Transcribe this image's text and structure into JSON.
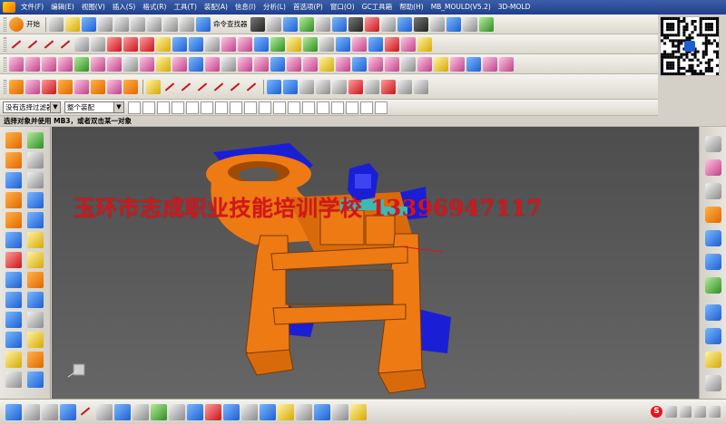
{
  "menubar": {
    "items": [
      "文件(F)",
      "编辑(E)",
      "视图(V)",
      "插入(S)",
      "格式(R)",
      "工具(T)",
      "装配(A)",
      "信息(I)",
      "分析(L)",
      "首选项(P)",
      "窗口(O)",
      "GC工具箱",
      "帮助(H)",
      "MB_MOULD(V5.2)",
      "3D-MOLD"
    ]
  },
  "toolbar": {
    "start_label": "开始",
    "command_finder_label": "命令查找器"
  },
  "selection": {
    "filter_value": "没有选择过滤器",
    "scope_value": "整个装配"
  },
  "cue": {
    "text": "选择对象并使用 MB3，或者双击某一对象"
  },
  "viewport": {
    "watermark": "玉环市志成职业技能培训学校  13396947117"
  },
  "colors": {
    "part_orange": "#ee7a14",
    "part_blue": "#1a1fd6",
    "watermark_red": "#d8141a",
    "background_top": "#4d4d4d"
  },
  "icons": {
    "start": "start-icon",
    "qr": "qr-code-icon",
    "view_triad": "view-triad-icon",
    "sogou": "sogou-input-icon"
  },
  "tray": {
    "sogou": "S"
  }
}
